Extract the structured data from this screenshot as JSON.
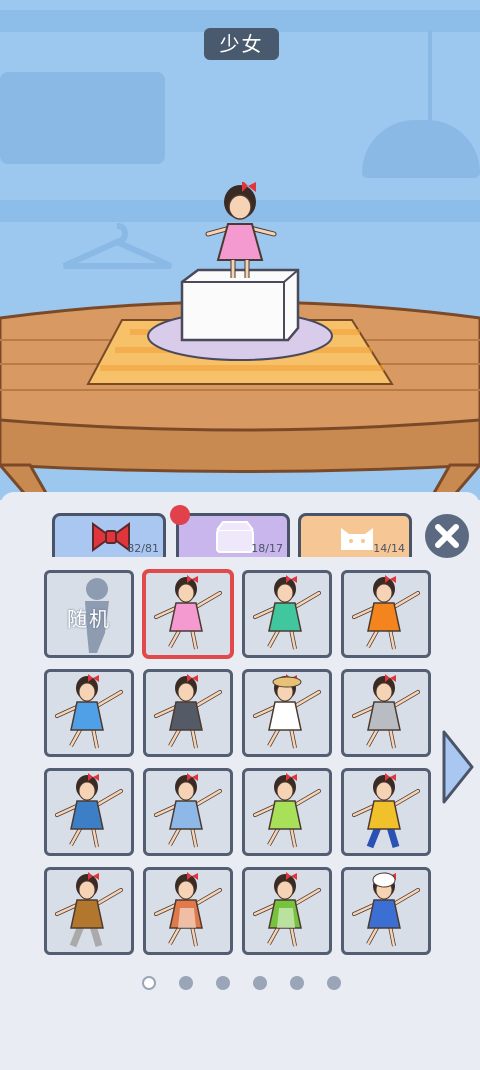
{
  "header": {
    "title": "少女"
  },
  "tabs": [
    {
      "icon": "bow-icon",
      "count": "82/81",
      "color": "#a9c7f0",
      "active": true
    },
    {
      "icon": "box-icon",
      "count": "18/17",
      "color": "#c8b6ec",
      "active": false,
      "has_badge": true
    },
    {
      "icon": "cat-icon",
      "count": "14/14",
      "color": "#f6c695",
      "active": false
    }
  ],
  "outfits": [
    {
      "label": "随机",
      "type": "random"
    },
    {
      "dress": "#f49ad0",
      "selected": true
    },
    {
      "dress": "#40c79e"
    },
    {
      "dress": "#f4841e"
    },
    {
      "dress": "#4fa0e6"
    },
    {
      "dress": "#545b66"
    },
    {
      "dress": "#ffffff",
      "hat": true
    },
    {
      "dress": "#b9bdc3",
      "plaid": true
    },
    {
      "dress": "#3d7fc6",
      "dots": true
    },
    {
      "dress": "#8db8e8",
      "stripes": true
    },
    {
      "dress": "#a9e05a"
    },
    {
      "dress": "#f0c12a",
      "pants": "#2a52b4"
    },
    {
      "dress": "#b2762c",
      "pants": "#aaaaaa"
    },
    {
      "dress": "#e07a4a",
      "apron": true
    },
    {
      "dress": "#77c33d",
      "apron": true
    },
    {
      "dress": "#3b6fd4",
      "baker": true
    }
  ],
  "pager": {
    "pages": 6,
    "current": 0
  },
  "colors": {
    "sky": "#9cc8f0",
    "table": "#d89a62",
    "accent": "#e04a4a"
  }
}
